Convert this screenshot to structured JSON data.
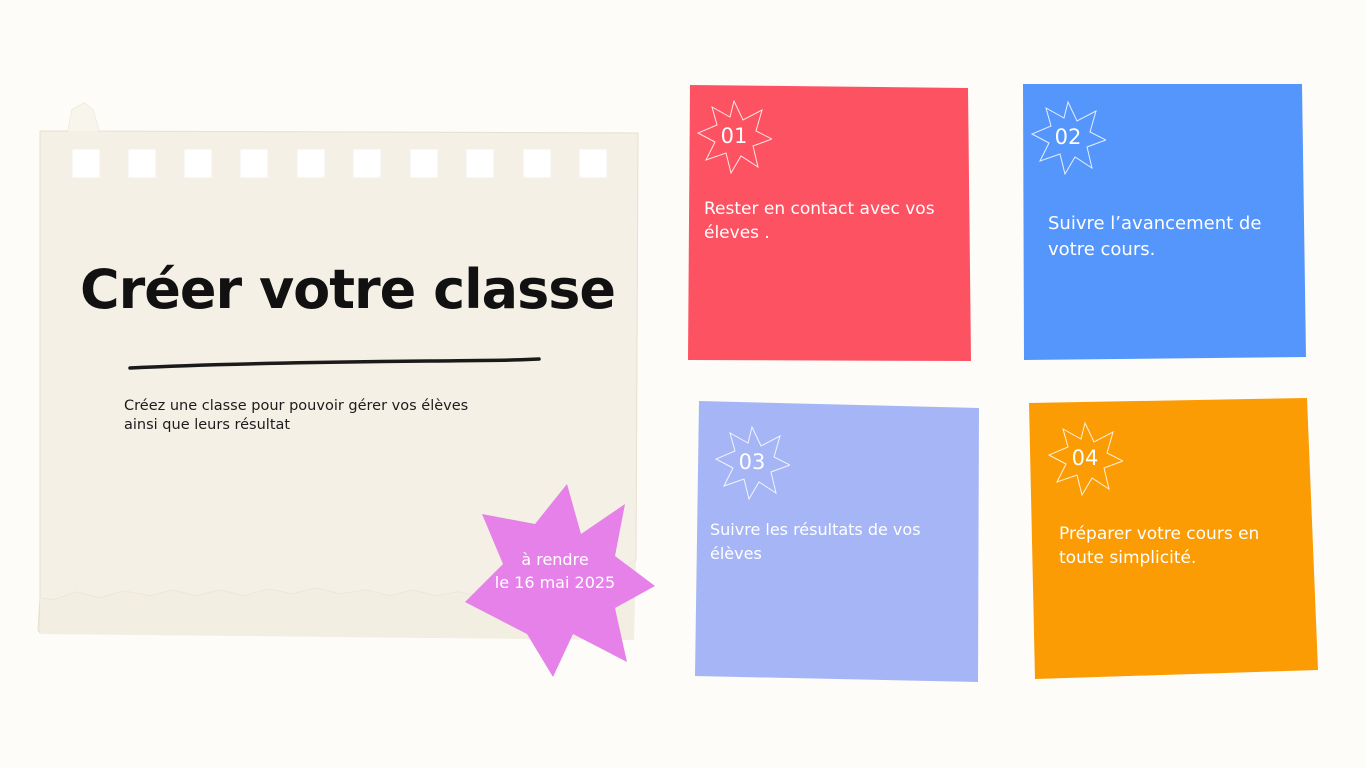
{
  "title": "Créer votre classe",
  "subtitle": "Créez une classe pour pouvoir gérer vos élèves ainsi que leurs résultat",
  "deadline": {
    "line1": "à rendre",
    "line2": "le 16 mai 2025"
  },
  "cards": [
    {
      "number": "01",
      "text": "Rester en contact avec vos éleves .",
      "color": "#fd5261"
    },
    {
      "number": "02",
      "text": "Suivre l’avancement de votre cours.",
      "color": "#5596fd"
    },
    {
      "number": "03",
      "text": "Suivre les résultats de vos élèves",
      "color": "#a6b5f6"
    },
    {
      "number": "04",
      "text": "Préparer votre cours en toute simplicité.",
      "color": "#fb9c04"
    }
  ],
  "colors": {
    "background": "#fdfcf9",
    "paper": "#f4f0e5",
    "star": "#e581e8",
    "text_dark": "#111111"
  }
}
